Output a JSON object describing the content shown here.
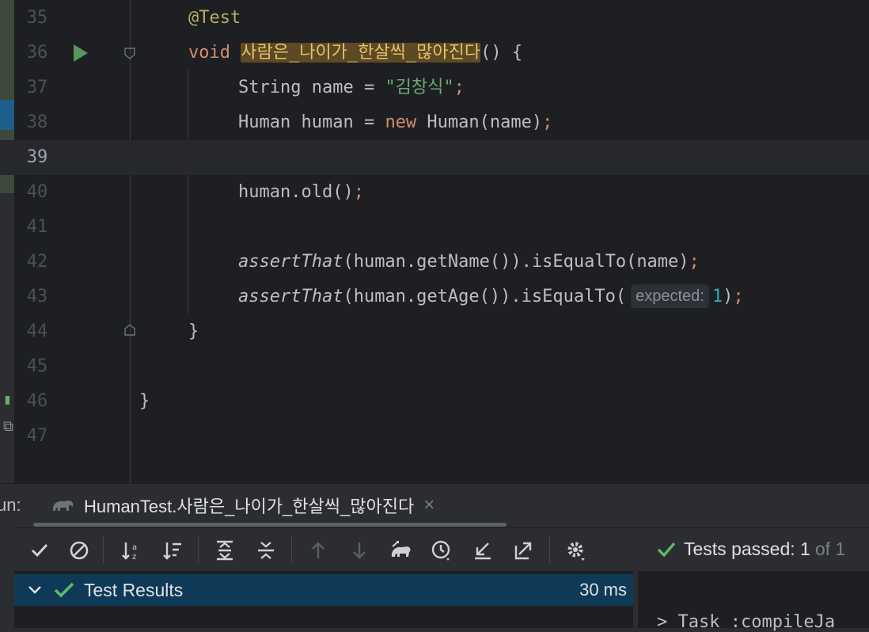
{
  "editor": {
    "lines": [
      {
        "num": "35",
        "text_ann": "@Test"
      },
      {
        "num": "36",
        "kw": "void",
        "method": "사람은_나이가_한살씩_많아진다",
        "rest": "() {"
      },
      {
        "num": "37",
        "type": "String name = ",
        "str": "\"김창식\"",
        "semi": ";"
      },
      {
        "num": "38",
        "type": "Human human = ",
        "kw": "new",
        "rest": " Human(name)",
        "semi": ";"
      },
      {
        "num": "39"
      },
      {
        "num": "40",
        "rest": "human.old()",
        "semi": ";"
      },
      {
        "num": "41"
      },
      {
        "num": "42",
        "it": "assertThat",
        "rest": "(human.getName()).isEqualTo(name)",
        "semi": ";"
      },
      {
        "num": "43",
        "it": "assertThat",
        "rest": "(human.getAge()).isEqualTo(",
        "hint": "expected:",
        "numval": "1",
        "close": ")",
        "semi": ";"
      },
      {
        "num": "44",
        "rest": "}"
      },
      {
        "num": "45"
      },
      {
        "num": "46",
        "rest": "}"
      },
      {
        "num": "47"
      }
    ]
  },
  "run_panel": {
    "label": "un:",
    "tab_title": "HumanTest.사람은_나이가_한살씩_많아진다",
    "tab_close": "×",
    "status_text": "Tests passed: 1",
    "status_of": "of 1",
    "results_label": "Test Results",
    "results_time": "30 ms",
    "console_text": "> Task :compileJa"
  },
  "colors": {
    "accent_green": "#5fb865",
    "selection": "#0f3a57",
    "method_highlight": "#5c4a24"
  }
}
